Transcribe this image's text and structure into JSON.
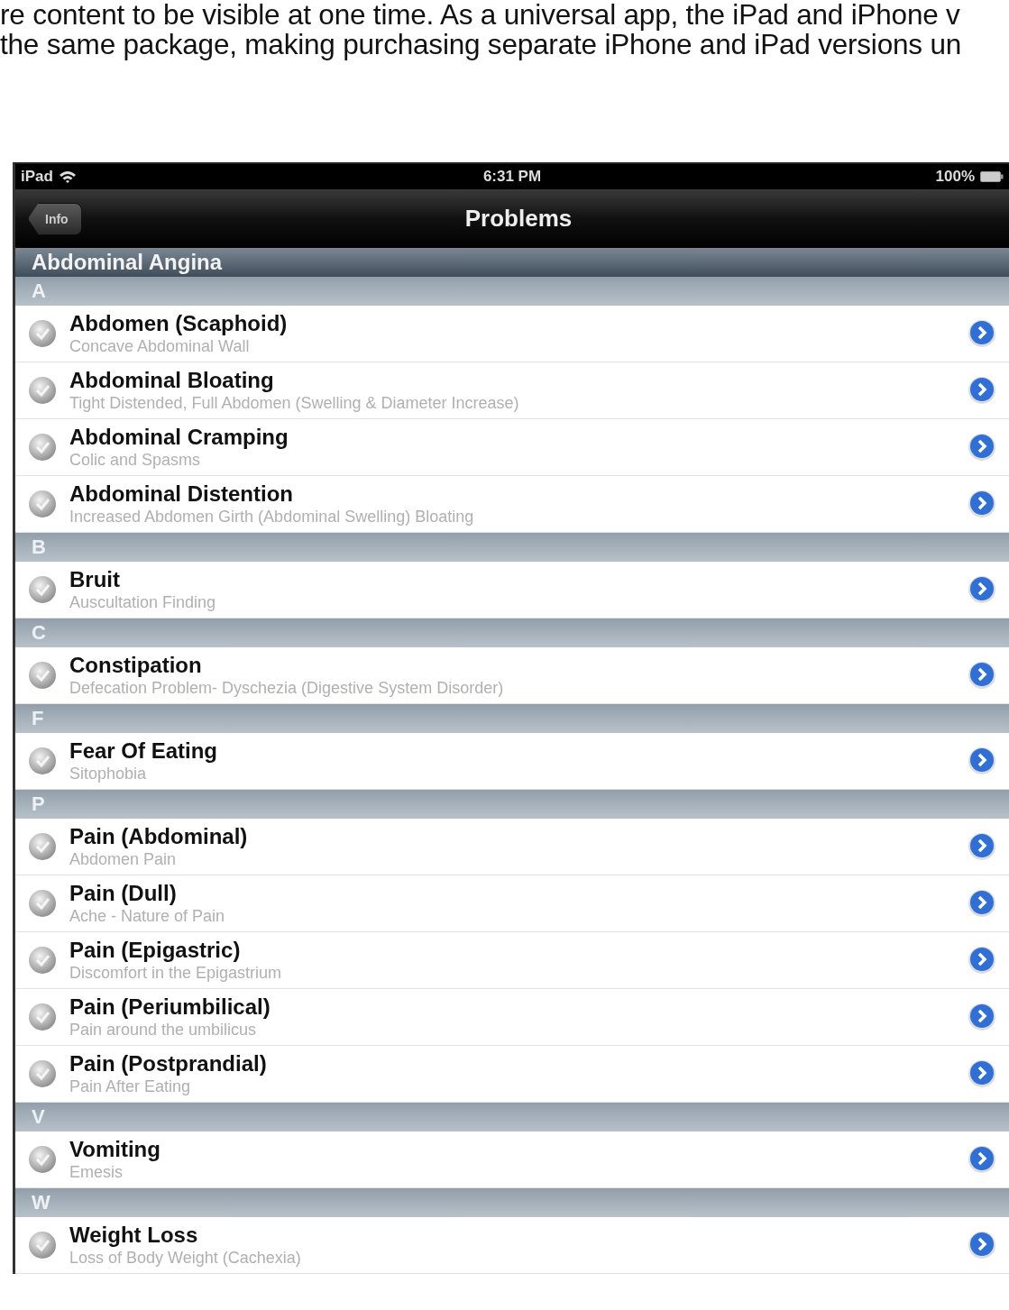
{
  "article_text": [
    "re content to be visible at one time. As a universal app, the iPad and iPhone v",
    "the same package, making purchasing separate iPhone and iPad versions un"
  ],
  "status_bar": {
    "carrier": "iPad",
    "time": "6:31 PM",
    "battery": "100%"
  },
  "nav_bar": {
    "back_button": "Info",
    "title": "Problems"
  },
  "list_header": "Abdominal Angina",
  "sections": [
    {
      "letter": "A",
      "rows": [
        {
          "title": "Abdomen (Scaphoid)",
          "subtitle": "Concave Abdominal Wall"
        },
        {
          "title": "Abdominal Bloating",
          "subtitle": "Tight Distended, Full Abdomen (Swelling & Diameter Increase)"
        },
        {
          "title": "Abdominal Cramping",
          "subtitle": "Colic and Spasms"
        },
        {
          "title": "Abdominal Distention",
          "subtitle": "Increased Abdomen Girth (Abdominal Swelling) Bloating"
        }
      ]
    },
    {
      "letter": "B",
      "rows": [
        {
          "title": "Bruit",
          "subtitle": "Auscultation Finding"
        }
      ]
    },
    {
      "letter": "C",
      "rows": [
        {
          "title": "Constipation",
          "subtitle": "Defecation Problem- Dyschezia (Digestive System Disorder)"
        }
      ]
    },
    {
      "letter": "F",
      "rows": [
        {
          "title": "Fear Of Eating",
          "subtitle": "Sitophobia"
        }
      ]
    },
    {
      "letter": "P",
      "rows": [
        {
          "title": "Pain (Abdominal)",
          "subtitle": "Abdomen Pain"
        },
        {
          "title": "Pain (Dull)",
          "subtitle": "Ache - Nature of Pain"
        },
        {
          "title": "Pain (Epigastric)",
          "subtitle": "Discomfort in the Epigastrium"
        },
        {
          "title": "Pain (Periumbilical)",
          "subtitle": "Pain around the umbilicus"
        },
        {
          "title": "Pain (Postprandial)",
          "subtitle": "Pain After Eating"
        }
      ]
    },
    {
      "letter": "V",
      "rows": [
        {
          "title": "Vomiting",
          "subtitle": "Emesis"
        }
      ]
    },
    {
      "letter": "W",
      "rows": [
        {
          "title": "Weight Loss",
          "subtitle": "Loss of Body Weight (Cachexia)"
        }
      ]
    }
  ]
}
